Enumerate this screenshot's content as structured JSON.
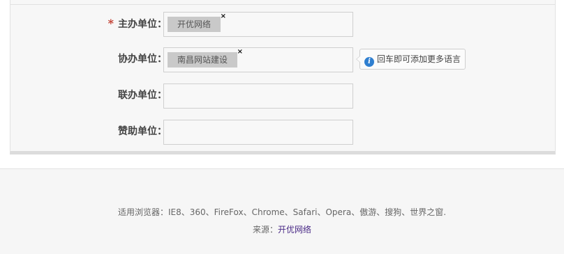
{
  "form": {
    "rows": [
      {
        "label": "主办单位：",
        "required_mark": "*",
        "tags": [
          "开优网络"
        ]
      },
      {
        "label": "协办单位：",
        "tags": [
          "南昌网站建设"
        ],
        "tip": "回车即可添加更多语言"
      },
      {
        "label": "联办单位：",
        "tags": []
      },
      {
        "label": "赞助单位：",
        "tags": []
      }
    ],
    "tag_remove_symbol": "×",
    "info_icon": "info-icon"
  },
  "footer": {
    "browsers": "适用浏览器：IE8、360、FireFox、Chrome、Safari、Opera、傲游、搜狗、世界之窗.",
    "source_label": "来源：",
    "source_link": "开优网络"
  },
  "colors": {
    "required": "#c0392b",
    "info": "#2f7fd0",
    "link": "#4a2a86",
    "tag_bg": "#c9c9c9"
  }
}
